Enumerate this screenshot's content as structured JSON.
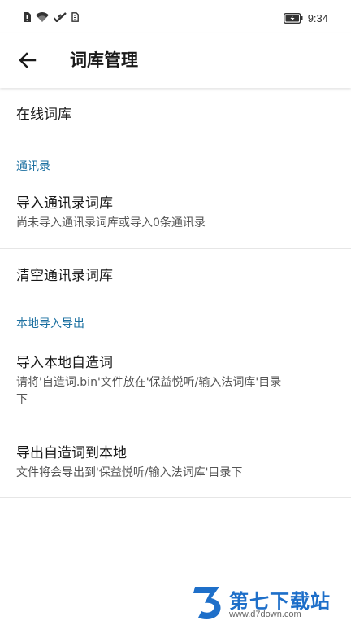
{
  "status_bar": {
    "time": "9:34",
    "icons": [
      "alert-icon",
      "wifi-icon",
      "signal-icon",
      "sim-icon",
      "battery-icon"
    ]
  },
  "app_bar": {
    "title": "词库管理",
    "back_icon": "arrow-left-icon"
  },
  "list": {
    "online_dict": {
      "title": "在线词库"
    },
    "contacts_section": {
      "header": "通讯录"
    },
    "import_contacts": {
      "title": "导入通讯录词库",
      "subtitle": "尚未导入通讯录词库或导入0条通讯录"
    },
    "clear_contacts": {
      "title": "清空通讯录词库"
    },
    "local_section": {
      "header": "本地导入导出"
    },
    "import_local": {
      "title": "导入本地自造词",
      "subtitle_line1": "请将'自造词.bin'文件放在'保益悦听/输入法词库'目录",
      "subtitle_line2": "下"
    },
    "export_local": {
      "title": "导出自造词到本地",
      "subtitle": "文件将会导出到'保益悦听/输入法词库'目录下"
    }
  },
  "watermark": {
    "brand": "第七下载站",
    "url": "www.d7down.com"
  },
  "colors": {
    "accent": "#1a6fa0",
    "watermark_blue": "#1e6fc9"
  }
}
